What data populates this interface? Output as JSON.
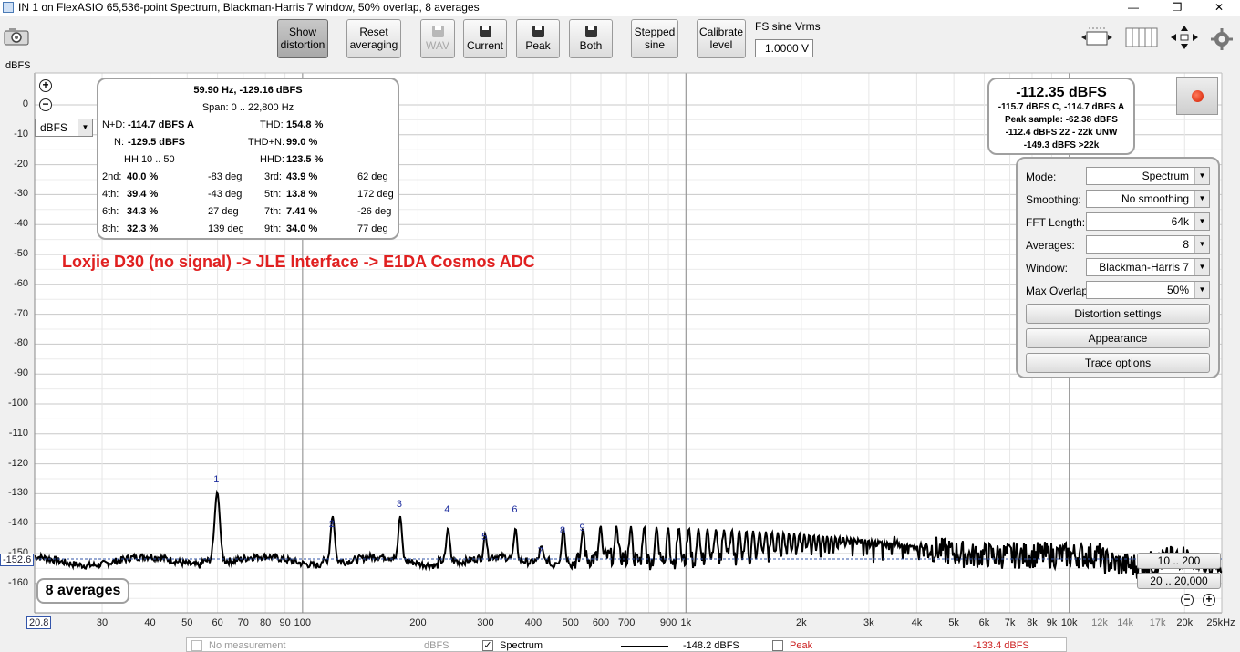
{
  "window": {
    "title": "IN 1 on FlexASIO 65,536-point Spectrum, Blackman-Harris 7 window, 50% overlap, 8 averages",
    "minimize": "—",
    "maximize": "❐",
    "close": "✕"
  },
  "toolbar": {
    "show_distortion": "Show distortion",
    "reset_averaging": "Reset averaging",
    "wav": "WAV",
    "current": "Current",
    "peak": "Peak",
    "both": "Both",
    "stepped_sine": "Stepped sine",
    "calibrate_level": "Calibrate level",
    "fs_label": "FS sine Vrms",
    "fs_value": "1.0000 V"
  },
  "plot": {
    "y_unit": "dBFS",
    "unit_select": "dBFS",
    "y_ticks": [
      "0",
      "-10",
      "-20",
      "-30",
      "-40",
      "-50",
      "-60",
      "-70",
      "-80",
      "-90",
      "-100",
      "-110",
      "-120",
      "-130",
      "-140",
      "-150",
      "-160"
    ],
    "cursor_y": "-152.6",
    "cursor_x": "20.8",
    "x_ticks": [
      "30",
      "40",
      "50",
      "60",
      "70",
      "80",
      "90",
      "100",
      "200",
      "300",
      "400",
      "500",
      "600",
      "700",
      "900",
      "1k",
      "2k",
      "3k",
      "4k",
      "5k",
      "6k",
      "7k",
      "8k",
      "9k",
      "10k",
      "12k",
      "14k",
      "17k",
      "20k",
      "25kHz"
    ],
    "harmonic_labels": [
      "1",
      "2",
      "3",
      "4",
      "5",
      "6",
      "7",
      "8",
      "9"
    ],
    "annotation": "Loxjie D30 (no signal) -> JLE Interface -> E1DA Cosmos ADC",
    "averages_badge": "8 averages",
    "range_a": "10 .. 200",
    "range_b": "20 .. 20,000"
  },
  "distortion": {
    "header": "59.90 Hz, -129.16 dBFS",
    "span": "Span: 0 .. 22,800 Hz",
    "nd_label": "N+D:",
    "nd_value": "-114.7 dBFS A",
    "thd_label": "THD:",
    "thd_value": "154.8 %",
    "n_label": "N:",
    "n_value": "-129.5 dBFS",
    "thdn_label": "THD+N:",
    "thdn_value": "99.0 %",
    "hh_label": "HH 10 .. 50",
    "hhd_label": "HHD:",
    "hhd_value": "123.5 %",
    "rows": [
      {
        "l1": "2nd:",
        "v1": "40.0 %",
        "d1": "-83 deg",
        "l2": "3rd:",
        "v2": "43.9 %",
        "d2": "62 deg"
      },
      {
        "l1": "4th:",
        "v1": "39.4 %",
        "d1": "-43 deg",
        "l2": "5th:",
        "v2": "13.8 %",
        "d2": "172 deg"
      },
      {
        "l1": "6th:",
        "v1": "34.3 %",
        "d1": "27 deg",
        "l2": "7th:",
        "v2": "7.41 %",
        "d2": "-26 deg"
      },
      {
        "l1": "8th:",
        "v1": "32.3 %",
        "d1": "139 deg",
        "l2": "9th:",
        "v2": "34.0 %",
        "d2": "77 deg"
      }
    ]
  },
  "readout": {
    "main": "-112.35 dBFS",
    "line1": "-115.7 dBFS C, -114.7 dBFS A",
    "line2": "Peak sample: -62.38 dBFS",
    "line3": "-112.4 dBFS 22 - 22k UNW",
    "line4": "-149.3 dBFS >22k"
  },
  "controls": {
    "mode_label": "Mode:",
    "mode_value": "Spectrum",
    "smoothing_label": "Smoothing:",
    "smoothing_value": "No  smoothing",
    "fft_label": "FFT Length:",
    "fft_value": "64k",
    "averages_label": "Averages:",
    "averages_value": "8",
    "window_label": "Window:",
    "window_value": "Blackman-Harris 7",
    "overlap_label": "Max Overlap:",
    "overlap_value": "50%",
    "distortion_settings": "Distortion settings",
    "appearance": "Appearance",
    "trace_options": "Trace options"
  },
  "legend": {
    "no_measurement": "No measurement",
    "no_measurement_unit": "dBFS",
    "spectrum": "Spectrum",
    "spectrum_value": "-148.2 dBFS",
    "peak": "Peak",
    "peak_value": "-133.4 dBFS",
    "peak_color": "#cc2020"
  }
}
